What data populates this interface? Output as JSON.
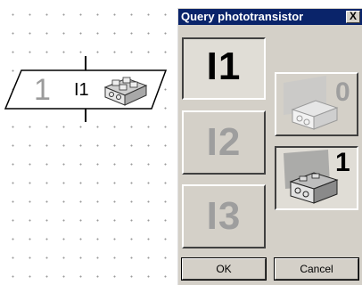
{
  "canvas": {
    "block": {
      "number": "1",
      "input": "I1",
      "icon": "phototransistor-brick-icon"
    }
  },
  "dialog": {
    "title": "Query phototransistor",
    "close_symbol": "X",
    "inputs": [
      {
        "label": "I1",
        "selected": true
      },
      {
        "label": "I2",
        "selected": false
      },
      {
        "label": "I3",
        "selected": false
      }
    ],
    "states": [
      {
        "label": "0",
        "icon": "phototransistor-dark-icon",
        "selected": false
      },
      {
        "label": "1",
        "icon": "phototransistor-lit-icon",
        "selected": true
      }
    ],
    "ok_label": "OK",
    "cancel_label": "Cancel"
  }
}
